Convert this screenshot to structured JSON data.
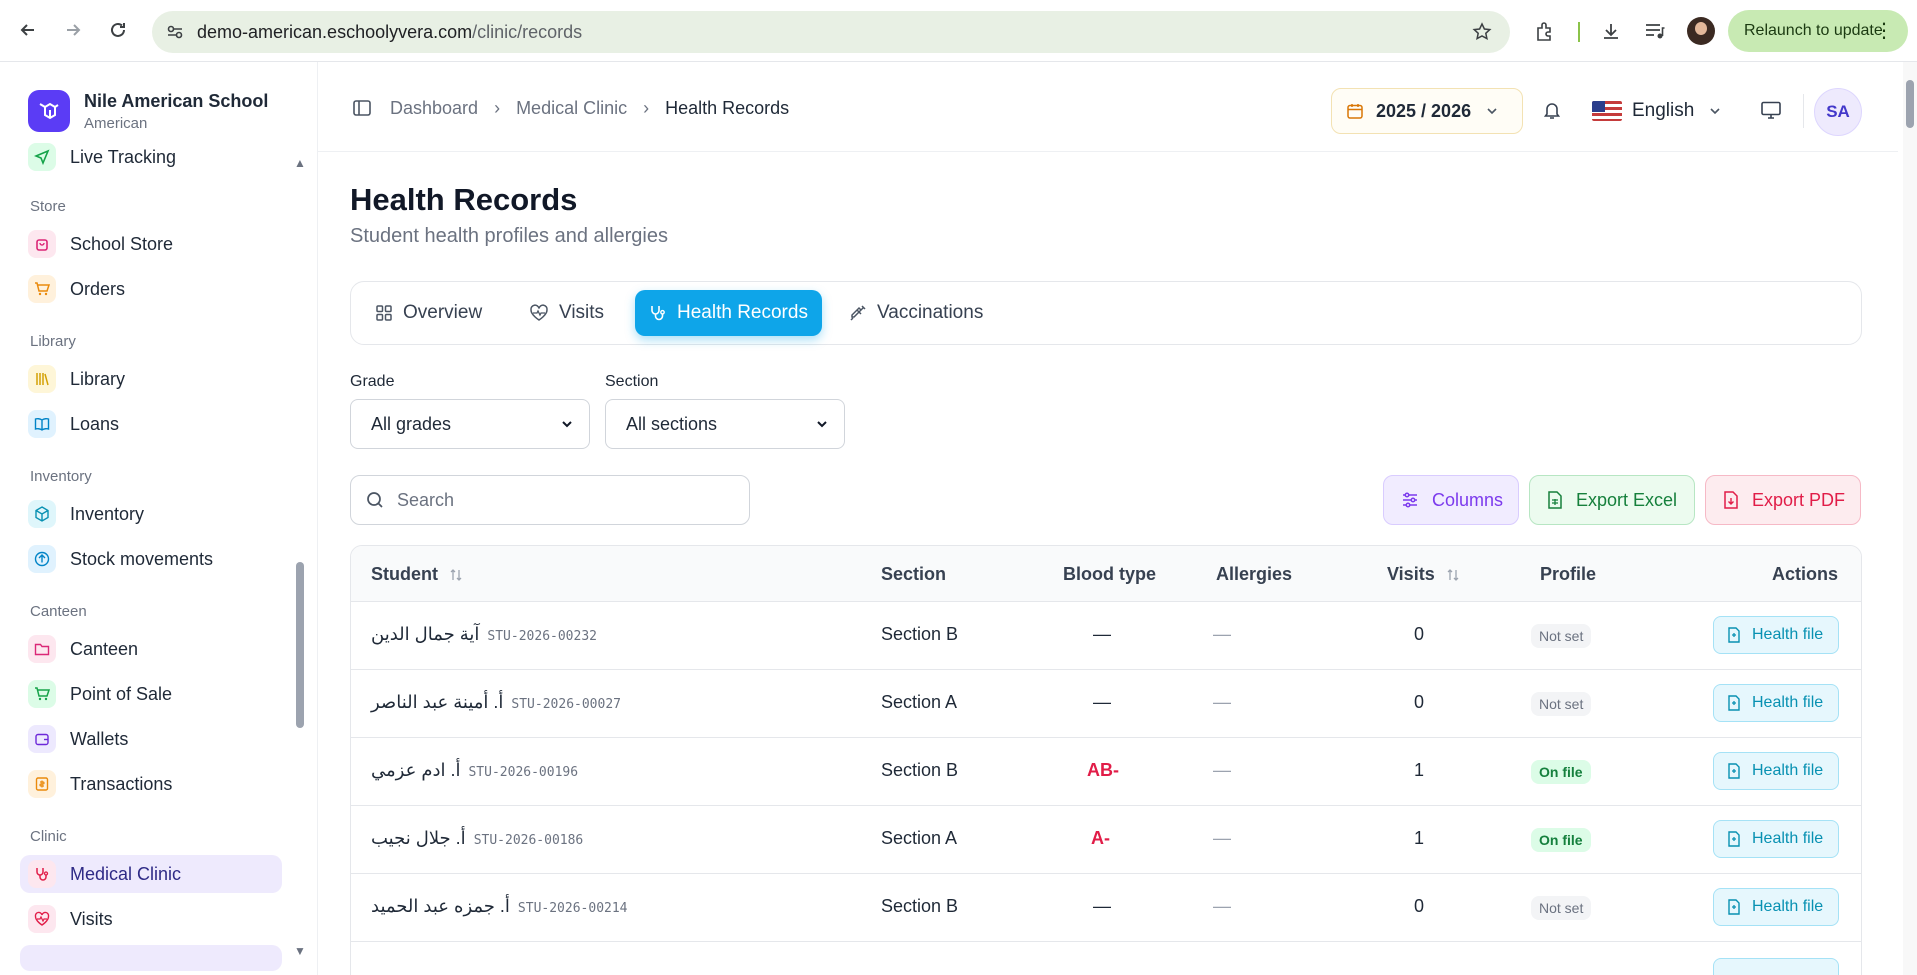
{
  "browser": {
    "url_host": "demo-american.eschoolyvera.com",
    "url_path": "/clinic/records",
    "relaunch_label": "Relaunch to update"
  },
  "school": {
    "name": "Nile American School",
    "subtitle": "American"
  },
  "sidebar": {
    "partial_top_item": "Live Tracking",
    "groups": [
      {
        "title": "Store",
        "items": [
          "School Store",
          "Orders"
        ]
      },
      {
        "title": "Library",
        "items": [
          "Library",
          "Loans"
        ]
      },
      {
        "title": "Inventory",
        "items": [
          "Inventory",
          "Stock movements"
        ]
      },
      {
        "title": "Canteen",
        "items": [
          "Canteen",
          "Point of Sale",
          "Wallets",
          "Transactions"
        ]
      },
      {
        "title": "Clinic",
        "items": [
          "Medical Clinic",
          "Visits"
        ]
      }
    ],
    "active_item": "Medical Clinic"
  },
  "header": {
    "breadcrumb": [
      "Dashboard",
      "Medical Clinic",
      "Health Records"
    ],
    "academic_year": "2025 / 2026",
    "language": "English",
    "avatar_initials": "SA"
  },
  "page": {
    "title": "Health Records",
    "subtitle": "Student health profiles and allergies"
  },
  "tabs": [
    {
      "label": "Overview",
      "icon": "grid-icon",
      "active": false
    },
    {
      "label": "Visits",
      "icon": "heart-pulse-icon",
      "active": false
    },
    {
      "label": "Health Records",
      "icon": "stethoscope-icon",
      "active": true
    },
    {
      "label": "Vaccinations",
      "icon": "syringe-icon",
      "active": false
    }
  ],
  "filters": {
    "grade_label": "Grade",
    "grade_value": "All grades",
    "section_label": "Section",
    "section_value": "All sections"
  },
  "search": {
    "placeholder": "Search"
  },
  "actions": {
    "columns": "Columns",
    "export_excel": "Export Excel",
    "export_pdf": "Export PDF"
  },
  "table": {
    "headers": [
      "Student",
      "Section",
      "Blood type",
      "Allergies",
      "Visits",
      "Profile",
      "Actions"
    ],
    "action_label": "Health file",
    "rows": [
      {
        "name": "آية جمال الدين",
        "id": "STU-2026-00232",
        "section": "Section B",
        "blood": "—",
        "allergies": "—",
        "visits": "0",
        "profile": "Not set"
      },
      {
        "name": "أ. أمينة عبد الناصر",
        "id": "STU-2026-00027",
        "section": "Section A",
        "blood": "—",
        "allergies": "—",
        "visits": "0",
        "profile": "Not set"
      },
      {
        "name": "أ. ادم عزمي",
        "id": "STU-2026-00196",
        "section": "Section B",
        "blood": "AB-",
        "allergies": "—",
        "visits": "1",
        "profile": "On file"
      },
      {
        "name": "أ. جلال نجيب",
        "id": "STU-2026-00186",
        "section": "Section A",
        "blood": "A-",
        "allergies": "—",
        "visits": "1",
        "profile": "On file"
      },
      {
        "name": "أ. جمزه عبد الحميد",
        "id": "STU-2026-00214",
        "section": "Section B",
        "blood": "—",
        "allergies": "—",
        "visits": "0",
        "profile": "Not set"
      }
    ]
  }
}
